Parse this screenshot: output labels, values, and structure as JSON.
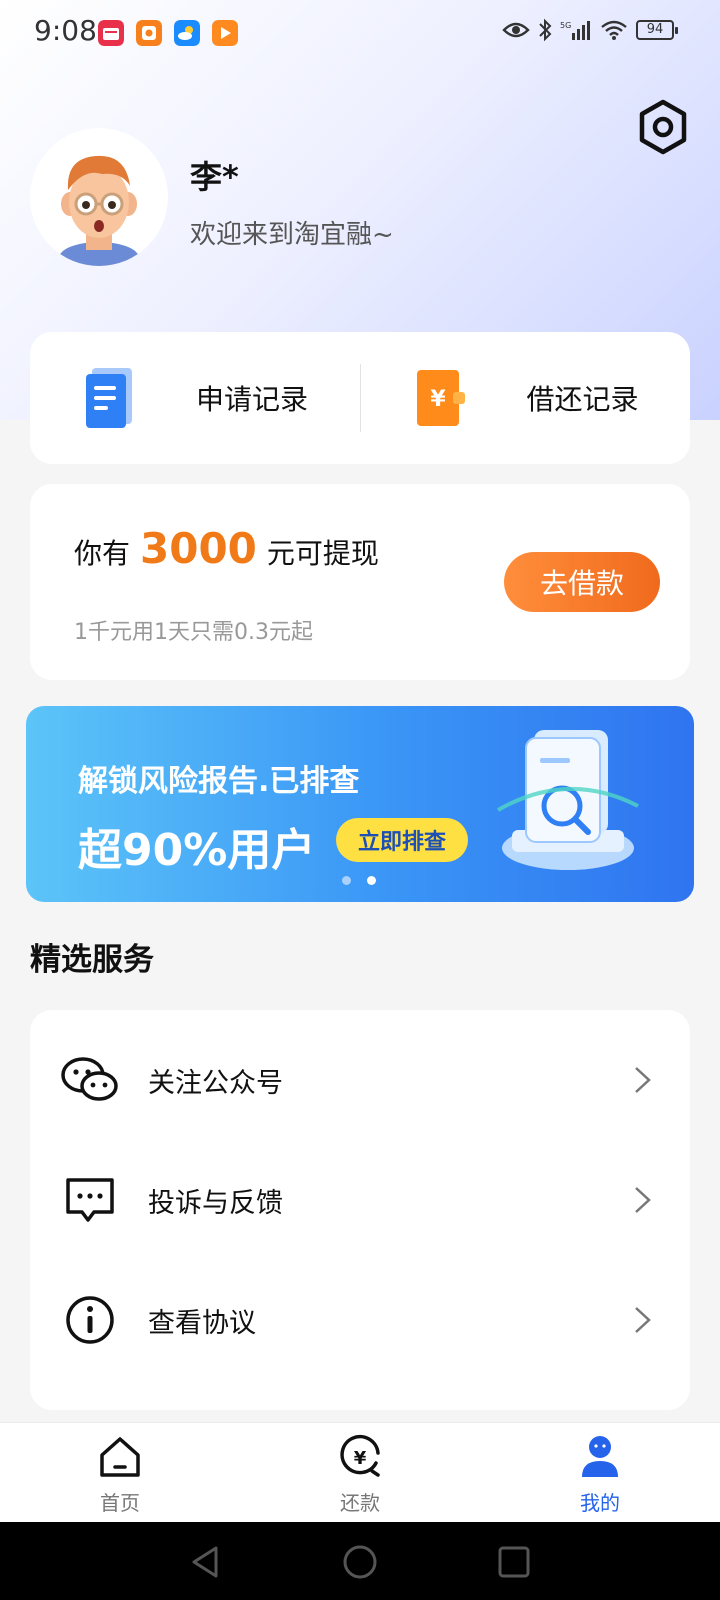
{
  "status_bar": {
    "time": "9:08",
    "battery": "94",
    "apps": [
      {
        "icon": "news-app-icon",
        "color": "#e8304a"
      },
      {
        "icon": "orange-app-icon",
        "color": "#f77f1c"
      },
      {
        "icon": "weather-app-icon",
        "color": "#1a8cff"
      },
      {
        "icon": "video-app-icon",
        "color": "#ff8a1f"
      }
    ],
    "indicators": [
      "eye-icon",
      "bluetooth-icon",
      "5g-signal-icon",
      "wifi-icon",
      "battery-icon"
    ]
  },
  "profile": {
    "name": "李*",
    "welcome": "欢迎来到淘宜融~"
  },
  "records": [
    {
      "label": "申请记录",
      "icon": "document-icon",
      "color": "#2f7ff5"
    },
    {
      "label": "借还记录",
      "icon": "yuan-wallet-icon",
      "color": "#ff8c1a"
    }
  ],
  "loan": {
    "prefix": "你有",
    "amount": "3000",
    "suffix": "元可提现",
    "subtitle": "1千元用1天只需0.3元起",
    "button": "去借款",
    "accent": "#f07a17"
  },
  "banner": {
    "line1": "解锁风险报告.已排查",
    "line2": "超90%用户",
    "cta": "立即排查",
    "active_index": 1,
    "page_count": 2
  },
  "services": {
    "title": "精选服务",
    "items": [
      {
        "label": "关注公众号",
        "icon": "wechat-icon"
      },
      {
        "label": "投诉与反馈",
        "icon": "feedback-icon"
      },
      {
        "label": "查看协议",
        "icon": "info-icon"
      }
    ]
  },
  "nav": {
    "items": [
      {
        "label": "首页",
        "icon": "home-icon"
      },
      {
        "label": "还款",
        "icon": "repay-icon"
      },
      {
        "label": "我的",
        "icon": "profile-icon"
      }
    ],
    "active": "我的",
    "active_color": "#2563eb"
  }
}
